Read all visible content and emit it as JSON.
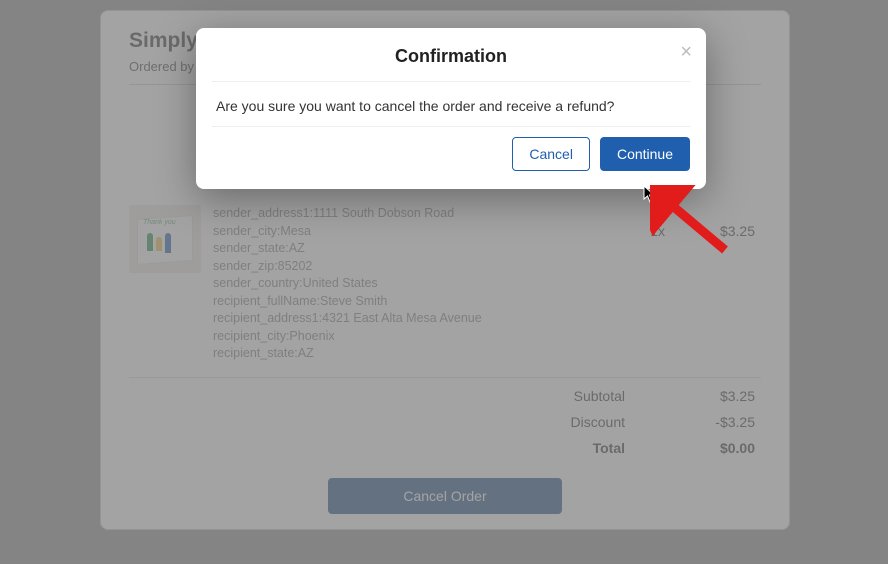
{
  "page": {
    "title_prefix": "Simply",
    "ordered_by_prefix": "Ordered by"
  },
  "item": {
    "thumb_label": "Thank you",
    "meta_lines": [
      "sender_address1:1111 South Dobson Road",
      "sender_city:Mesa",
      "sender_state:AZ",
      "sender_zip:85202",
      "sender_country:United States",
      "recipient_fullName:Steve Smith",
      "recipient_address1:4321 East Alta Mesa Avenue",
      "recipient_city:Phoenix",
      "recipient_state:AZ"
    ],
    "qty": "1x",
    "price": "$3.25"
  },
  "totals": {
    "subtotal_label": "Subtotal",
    "subtotal_value": "$3.25",
    "discount_label": "Discount",
    "discount_value": "-$3.25",
    "total_label": "Total",
    "total_value": "$0.00"
  },
  "buttons": {
    "cancel_order": "Cancel Order"
  },
  "modal": {
    "title": "Confirmation",
    "body": "Are you sure you want to cancel the order and receive a refund?",
    "cancel": "Cancel",
    "continue": "Continue"
  }
}
